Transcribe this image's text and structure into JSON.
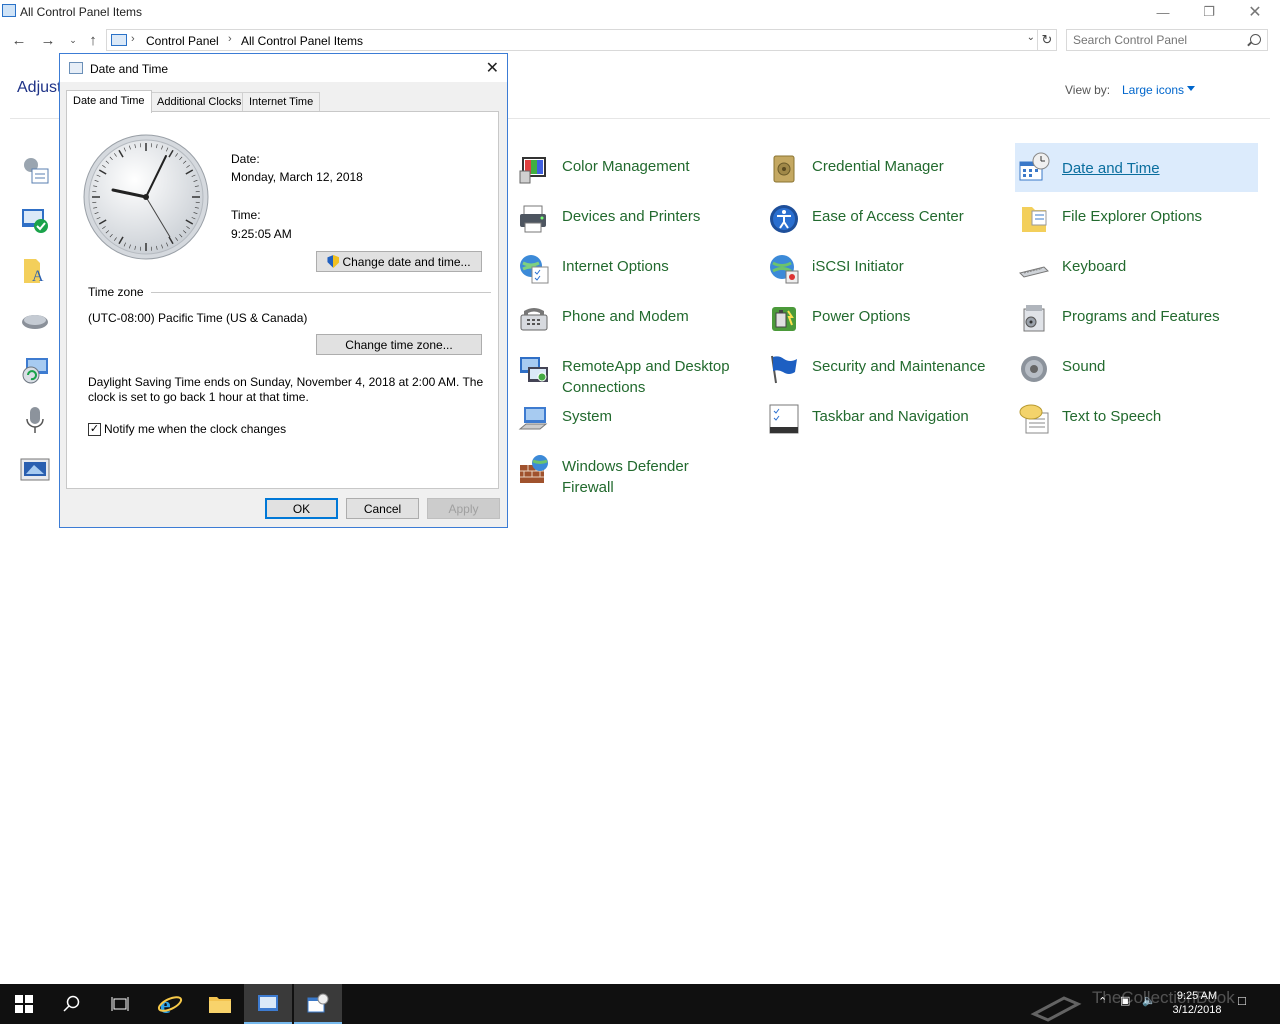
{
  "window": {
    "title": "All Control Panel Items"
  },
  "address": {
    "crumbs": [
      "Control Panel",
      "All Control Panel Items"
    ],
    "search_placeholder": "Search Control Panel"
  },
  "header": {
    "title_partial": "Adjust",
    "view_by_label": "View by:",
    "view_by_value": "Large icons"
  },
  "items": [
    {
      "label": "Color Management",
      "icon": "color-management-icon"
    },
    {
      "label": "Credential Manager",
      "icon": "credential-manager-icon"
    },
    {
      "label": "Date and Time",
      "icon": "date-time-icon",
      "selected": true
    },
    {
      "label": "Devices and Printers",
      "icon": "printer-icon"
    },
    {
      "label": "Ease of Access Center",
      "icon": "ease-of-access-icon"
    },
    {
      "label": "File Explorer Options",
      "icon": "folder-options-icon"
    },
    {
      "label": "Internet Options",
      "icon": "internet-options-icon"
    },
    {
      "label": "iSCSI Initiator",
      "icon": "iscsi-icon"
    },
    {
      "label": "Keyboard",
      "icon": "keyboard-icon"
    },
    {
      "label": "Phone and Modem",
      "icon": "phone-modem-icon"
    },
    {
      "label": "Power Options",
      "icon": "power-options-icon"
    },
    {
      "label": "Programs and Features",
      "icon": "programs-features-icon"
    },
    {
      "label": "RemoteApp and Desktop",
      "label2": "Connections",
      "icon": "remoteapp-icon"
    },
    {
      "label": "Security and Maintenance",
      "icon": "security-flag-icon"
    },
    {
      "label": "Sound",
      "icon": "speaker-icon"
    },
    {
      "label": "System",
      "icon": "system-icon"
    },
    {
      "label": "Taskbar and Navigation",
      "icon": "taskbar-icon"
    },
    {
      "label": "Text to Speech",
      "icon": "speech-bubble-icon"
    },
    {
      "label": "Windows Defender",
      "label2": "Firewall",
      "icon": "firewall-icon"
    }
  ],
  "dialog": {
    "title": "Date and Time",
    "tabs": [
      "Date and Time",
      "Additional Clocks",
      "Internet Time"
    ],
    "date_label": "Date:",
    "date_value": "Monday, March 12, 2018",
    "time_label": "Time:",
    "time_value": "9:25:05 AM",
    "change_datetime_button": "Change date and time...",
    "timezone_group": "Time zone",
    "timezone_value": "(UTC-08:00) Pacific Time (US & Canada)",
    "change_timezone_button": "Change time zone...",
    "dst_line1": "Daylight Saving Time ends on Sunday, November 4, 2018 at 2:00 AM. The",
    "dst_line2": "clock is set to go back 1 hour at that time.",
    "notify_label": "Notify me when the clock changes",
    "notify_checked": true,
    "ok": "OK",
    "cancel": "Cancel",
    "apply": "Apply"
  },
  "taskbar": {
    "clock_time": "9:25 AM",
    "clock_date": "3/12/2018",
    "watermark": "TheCollectionBook"
  },
  "colors": {
    "link_green": "#226a2e",
    "selected_bg": "#dcebfc",
    "taskbar": "#101010",
    "accent": "#0078d7"
  }
}
